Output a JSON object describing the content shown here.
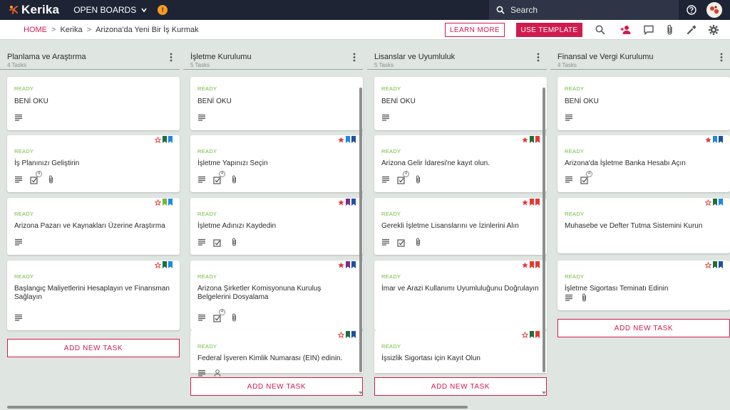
{
  "app": {
    "brand": "Kerika",
    "open_boards": "OPEN BOARDS",
    "notification_badge": "!",
    "search_placeholder": "Search"
  },
  "breadcrumb": {
    "home": "HOME",
    "separator": ">",
    "items": [
      "Kerika",
      "Arizona'da Yeni Bir İş Kurmak"
    ]
  },
  "actions": {
    "learn_more": "LEARN MORE",
    "use_template": "USE TEMPLATE"
  },
  "icons": [
    "search-icon",
    "add-person-icon",
    "chat-icon",
    "attachment-icon",
    "tools-icon",
    "gear-icon",
    "help-icon"
  ],
  "colors": {
    "topbar": "#1e2434",
    "accent": "#d11b4f",
    "ready": "#6cbb3a",
    "background": "#dfe5e1"
  },
  "add_task_label": "ADD NEW TASK",
  "columns": [
    {
      "title": "Planlama ve Araştırma",
      "count": "4 Tasks",
      "cards": [
        {
          "status": "READY",
          "title": "BENİ OKU",
          "star": "none",
          "bookmarks": [],
          "icons": [
            "details"
          ],
          "checklist_count": ""
        },
        {
          "status": "READY",
          "title": "İş Planınızı Geliştirin",
          "star": "outline",
          "bookmarks": [
            "#1b6f3a",
            "#1e88e5"
          ],
          "icons": [
            "details",
            "checklist",
            "attachment"
          ],
          "checklist_count": "4"
        },
        {
          "status": "READY",
          "title": "Arizona Pazarı ve Kaynakları Üzerine Araştırma",
          "star": "outline",
          "bookmarks": [
            "#6cbb3a",
            "#1e88e5"
          ],
          "icons": [
            "details"
          ],
          "checklist_count": ""
        },
        {
          "status": "READY",
          "title": "Başlangıç Maliyetlerini Hesaplayın ve Finansman Sağlayın",
          "star": "outline",
          "bookmarks": [
            "#1b6f3a",
            "#1e88e5"
          ],
          "icons": [
            "details"
          ],
          "checklist_count": ""
        }
      ]
    },
    {
      "title": "İşletme Kurulumu",
      "count": "5 Tasks",
      "cards": [
        {
          "status": "READY",
          "title": "BENİ OKU",
          "star": "none",
          "bookmarks": [],
          "icons": [
            "details"
          ],
          "checklist_count": ""
        },
        {
          "status": "READY",
          "title": "İşletme Yapınızı Seçin",
          "star": "filled",
          "bookmarks": [
            "#1e88e5",
            "#1e4fa3"
          ],
          "icons": [
            "details",
            "checklist",
            "attachment"
          ],
          "checklist_count": "4"
        },
        {
          "status": "READY",
          "title": "İşletme Adınızı Kaydedin",
          "star": "filled",
          "bookmarks": [
            "#7b2d8e",
            "#1e4fa3"
          ],
          "icons": [
            "details",
            "checklist",
            "attachment"
          ],
          "checklist_count": ""
        },
        {
          "status": "READY",
          "title": "Arizona Şirketler Komisyonuna Kuruluş Belgelerini Dosyalama",
          "star": "filled",
          "bookmarks": [
            "#7b2d8e",
            "#1e4fa3"
          ],
          "icons": [
            "details",
            "checklist",
            "attachment"
          ],
          "checklist_count": "4"
        },
        {
          "status": "READY",
          "title": "Federal İşveren Kimlik Numarası (EIN) edinin.",
          "star": "outline",
          "bookmarks": [
            "#1b6f3a",
            "#1e4fa3"
          ],
          "icons": [
            "details",
            "person"
          ],
          "checklist_count": ""
        }
      ]
    },
    {
      "title": "Lisanslar ve Uyumluluk",
      "count": "5 Tasks",
      "cards": [
        {
          "status": "READY",
          "title": "BENİ OKU",
          "star": "none",
          "bookmarks": [],
          "icons": [
            "details"
          ],
          "checklist_count": ""
        },
        {
          "status": "READY",
          "title": "Arizona Gelir İdaresi'ne kayıt olun.",
          "star": "filled",
          "bookmarks": [
            "#1b6f3a",
            "#e53935"
          ],
          "icons": [
            "details",
            "checklist",
            "attachment"
          ],
          "checklist_count": "4"
        },
        {
          "status": "READY",
          "title": "Gerekli İşletme Lisanslarını ve İzinlerini Alın",
          "star": "filled",
          "bookmarks": [
            "#e53935",
            "#e53935"
          ],
          "icons": [
            "details",
            "checklist",
            "attachment"
          ],
          "checklist_count": ""
        },
        {
          "status": "READY",
          "title": "İmar ve Arazi Kullanımı Uyumluluğunu Doğrulayın",
          "star": "filled",
          "bookmarks": [
            "#e53935",
            "#e53935"
          ],
          "icons": [],
          "checklist_count": ""
        },
        {
          "status": "READY",
          "title": "İşsizlik Sigortası için Kayıt Olun",
          "star": "outline",
          "bookmarks": [
            "#1b6f3a",
            "#e53935"
          ],
          "icons": [],
          "checklist_count": ""
        }
      ]
    },
    {
      "title": "Finansal ve Vergi Kurulumu",
      "count": "4 Tasks",
      "cards": [
        {
          "status": "READY",
          "title": "BENİ OKU",
          "star": "none",
          "bookmarks": [],
          "icons": [
            "details"
          ],
          "checklist_count": ""
        },
        {
          "status": "READY",
          "title": "Arizona'da İşletme Banka Hesabı Açın",
          "star": "filled",
          "bookmarks": [
            "#1e88e5",
            "#1e4fa3"
          ],
          "icons": [
            "details",
            "checklist"
          ],
          "checklist_count": "4"
        },
        {
          "status": "READY",
          "title": "Muhasebe ve Defter Tutma Sistemini Kurun",
          "star": "outline",
          "bookmarks": [
            "#1b6f3a",
            "#1e88e5"
          ],
          "icons": [],
          "checklist_count": ""
        },
        {
          "status": "READY",
          "title": "İşletme Sigortası Teminatı Edinin",
          "star": "outline",
          "bookmarks": [
            "#1b6f3a",
            "#1e4fa3"
          ],
          "icons": [
            "details",
            "attachment"
          ],
          "checklist_count": ""
        }
      ]
    }
  ]
}
